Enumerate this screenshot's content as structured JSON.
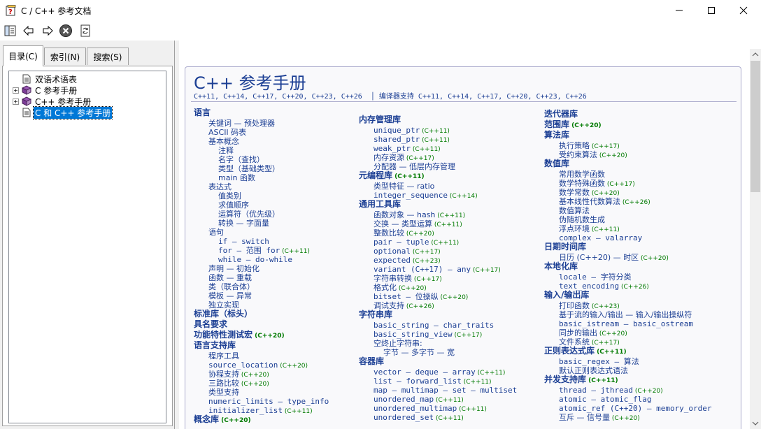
{
  "window": {
    "title": "C / C++ 参考文档"
  },
  "tabs": [
    {
      "label": "目录(C)"
    },
    {
      "label": "索引(N)"
    },
    {
      "label": "搜索(S)"
    }
  ],
  "tree": [
    {
      "label": "双语术语表",
      "expander": ""
    },
    {
      "label": "C 参考手册",
      "expander": "+"
    },
    {
      "label": "C++ 参考手册",
      "expander": "+"
    },
    {
      "label": "C 和 C++ 参考手册",
      "expander": ""
    }
  ],
  "page": {
    "title": "C++ 参考手册",
    "subtitle": "C++11, C++14, C++17, C++20, C++23, C++26  │ 编译器支持 C++11, C++14, C++17, C++20, C++23, C++26"
  },
  "col1": [
    {
      "t": "语言",
      "c": "h"
    },
    {
      "t": "关键词 — 预处理器",
      "c": "l1"
    },
    {
      "t": "ASCII 码表",
      "c": "l1"
    },
    {
      "t": "基本概念",
      "c": "l1"
    },
    {
      "t": "注释",
      "c": "l2"
    },
    {
      "t": "名字（查找）",
      "c": "l2"
    },
    {
      "t": "类型（基础类型）",
      "c": "l2"
    },
    {
      "t": "main 函数",
      "c": "l2"
    },
    {
      "t": "表达式",
      "c": "l1"
    },
    {
      "t": "值类别",
      "c": "l2"
    },
    {
      "t": "求值顺序",
      "c": "l2"
    },
    {
      "t": "运算符（优先级）",
      "c": "l2"
    },
    {
      "t": "转换 — 字面量",
      "c": "l2"
    },
    {
      "t": "语句",
      "c": "l1"
    },
    {
      "t": "if — switch",
      "c": "l2m"
    },
    {
      "t": "for — 范围 for",
      "v": "(C++11)",
      "c": "l2m"
    },
    {
      "t": "while — do-while",
      "c": "l2m"
    },
    {
      "t": "声明 — 初始化",
      "c": "l1"
    },
    {
      "t": "函数 — 重载",
      "c": "l1"
    },
    {
      "t": "类（联合体）",
      "c": "l1"
    },
    {
      "t": "模板 — 异常",
      "c": "l1"
    },
    {
      "t": "独立实现",
      "c": "l1"
    },
    {
      "t": "标准库（标头）",
      "c": "h"
    },
    {
      "t": "具名要求",
      "c": "h"
    },
    {
      "t": "功能特性测试宏",
      "v": "(C++20)",
      "c": "h"
    },
    {
      "t": "语言支持库",
      "c": "h"
    },
    {
      "t": "程序工具",
      "c": "l1"
    },
    {
      "t": "source_location",
      "v": "(C++20)",
      "c": "l1m"
    },
    {
      "t": "协程支持",
      "v": "(C++20)",
      "c": "l1"
    },
    {
      "t": "三路比较",
      "v": "(C++20)",
      "c": "l1"
    },
    {
      "t": "类型支持",
      "c": "l1"
    },
    {
      "t": "numeric_limits — type_info",
      "c": "l1m"
    },
    {
      "t": "initializer_list",
      "v": "(C++11)",
      "c": "l1m"
    },
    {
      "t": "概念库",
      "v": "(C++20)",
      "c": "h"
    }
  ],
  "col2": [
    {
      "t": "内存管理库",
      "c": "h"
    },
    {
      "t": "unique_ptr",
      "v": "(C++11)",
      "c": "l1m"
    },
    {
      "t": "shared_ptr",
      "v": "(C++11)",
      "c": "l1m"
    },
    {
      "t": "weak_ptr",
      "v": "(C++11)",
      "c": "l1m"
    },
    {
      "t": "内存资源",
      "v": "(C++17)",
      "c": "l1"
    },
    {
      "t": "分配器 — 低层内存管理",
      "c": "l1"
    },
    {
      "t": "元编程库",
      "v": "(C++11)",
      "c": "h"
    },
    {
      "t": "类型特征 — ratio",
      "c": "l1"
    },
    {
      "t": "integer_sequence",
      "v": "(C++14)",
      "c": "l1m"
    },
    {
      "t": "通用工具库",
      "c": "h"
    },
    {
      "t": "函数对象 — hash",
      "v": "(C++11)",
      "c": "l1"
    },
    {
      "t": "交换 — 类型运算",
      "v": "(C++11)",
      "c": "l1"
    },
    {
      "t": "整数比较",
      "v": "(C++20)",
      "c": "l1"
    },
    {
      "t": "pair — tuple",
      "v": "(C++11)",
      "c": "l1m"
    },
    {
      "t": "optional",
      "v": "(C++17)",
      "c": "l1m"
    },
    {
      "t": "expected",
      "v": "(C++23)",
      "c": "l1m"
    },
    {
      "t": "variant (C++17) — any",
      "v": "(C++17)",
      "c": "l1m"
    },
    {
      "t": "字符串转换",
      "v": "(C++17)",
      "c": "l1"
    },
    {
      "t": "格式化",
      "v": "(C++20)",
      "c": "l1"
    },
    {
      "t": "bitset — 位操纵",
      "v": "(C++20)",
      "c": "l1m"
    },
    {
      "t": "调试支持",
      "v": "(C++26)",
      "c": "l1"
    },
    {
      "t": "字符串库",
      "c": "h"
    },
    {
      "t": "basic_string — char_traits",
      "c": "l1m"
    },
    {
      "t": "basic_string_view",
      "v": "(C++17)",
      "c": "l1m"
    },
    {
      "t": "空终止字符串:",
      "c": "l1"
    },
    {
      "t": "字节 — 多字节 — 宽",
      "c": "l2"
    },
    {
      "t": "容器库",
      "c": "h"
    },
    {
      "t": "vector — deque — array",
      "v": "(C++11)",
      "c": "l1m"
    },
    {
      "t": "list — forward_list",
      "v": "(C++11)",
      "c": "l1m"
    },
    {
      "t": "map — multimap — set — multiset",
      "c": "l1m"
    },
    {
      "t": "unordered_map",
      "v": "(C++11)",
      "c": "l1m"
    },
    {
      "t": "unordered_multimap",
      "v": "(C++11)",
      "c": "l1m"
    },
    {
      "t": "unordered_set",
      "v": "(C++11)",
      "c": "l1m"
    }
  ],
  "col3": [
    {
      "t": "迭代器库",
      "c": "h"
    },
    {
      "t": "范围库",
      "v": "(C++20)",
      "c": "h"
    },
    {
      "t": "算法库",
      "c": "h"
    },
    {
      "t": "执行策略",
      "v": "(C++17)",
      "c": "l1"
    },
    {
      "t": "受约束算法",
      "v": "(C++20)",
      "c": "l1"
    },
    {
      "t": "数值库",
      "c": "h"
    },
    {
      "t": "常用数学函数",
      "c": "l1"
    },
    {
      "t": "数学特殊函数",
      "v": "(C++17)",
      "c": "l1"
    },
    {
      "t": "数学常数",
      "v": "(C++20)",
      "c": "l1"
    },
    {
      "t": "基本线性代数算法",
      "v": "(C++26)",
      "c": "l1"
    },
    {
      "t": "数值算法",
      "c": "l1"
    },
    {
      "t": "伪随机数生成",
      "c": "l1"
    },
    {
      "t": "浮点环境",
      "v": "(C++11)",
      "c": "l1"
    },
    {
      "t": "complex — valarray",
      "c": "l1m"
    },
    {
      "t": "日期时间库",
      "c": "h"
    },
    {
      "t": "日历 (C++20) — 时区",
      "v": "(C++20)",
      "c": "l1"
    },
    {
      "t": "本地化库",
      "c": "h"
    },
    {
      "t": "locale — 字符分类",
      "c": "l1m"
    },
    {
      "t": "text_encoding",
      "v": "(C++26)",
      "c": "l1m"
    },
    {
      "t": "输入/输出库",
      "c": "h"
    },
    {
      "t": "打印函数",
      "v": "(C++23)",
      "c": "l1"
    },
    {
      "t": "基于流的输入/输出 — 输入/输出操纵符",
      "c": "l1"
    },
    {
      "t": "basic_istream — basic_ostream",
      "c": "l1m"
    },
    {
      "t": "同步的输出",
      "v": "(C++20)",
      "c": "l1"
    },
    {
      "t": "文件系统",
      "v": "(C++17)",
      "c": "l1"
    },
    {
      "t": "正则表达式库",
      "v": "(C++11)",
      "c": "h"
    },
    {
      "t": "basic_regex — 算法",
      "c": "l1m"
    },
    {
      "t": "默认正则表达式语法",
      "c": "l1"
    },
    {
      "t": "并发支持库",
      "v": "(C++11)",
      "c": "h"
    },
    {
      "t": "thread — jthread",
      "v": "(C++20)",
      "c": "l1m"
    },
    {
      "t": "atomic — atomic_flag",
      "c": "l1m"
    },
    {
      "t": "atomic_ref (C++20) — memory_order",
      "c": "l1m"
    },
    {
      "t": "互斥 — 信号量",
      "v": "(C++20)",
      "c": "l1"
    }
  ]
}
